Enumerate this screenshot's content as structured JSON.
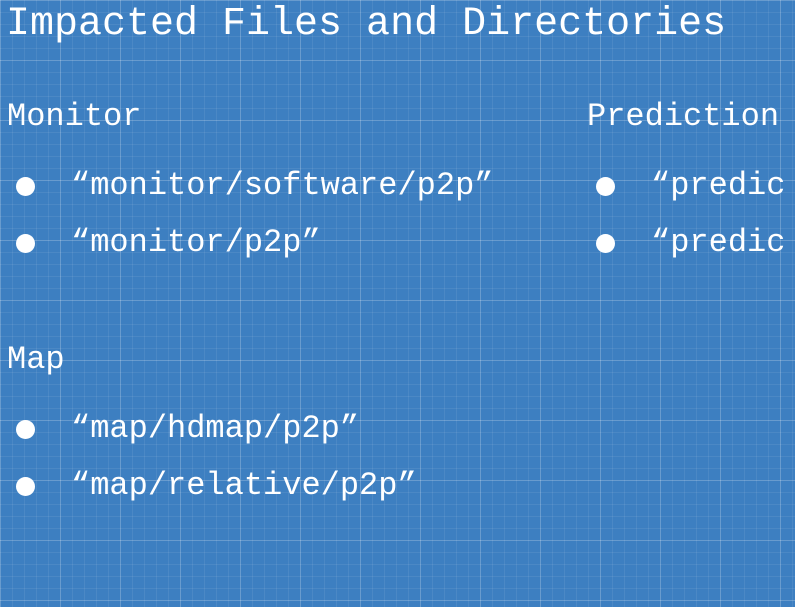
{
  "title": "Impacted Files and Directories",
  "sections": {
    "monitor": {
      "heading": "Monitor",
      "items": [
        "“monitor/software/p2p”",
        "“monitor/p2p”"
      ]
    },
    "prediction": {
      "heading": "Prediction",
      "items": [
        "“predic",
        "“predic"
      ]
    },
    "map": {
      "heading": "Map",
      "items": [
        "“map/hdmap/p2p”",
        "“map/relative/p2p”"
      ]
    }
  },
  "colors": {
    "background": "#3d7fc1",
    "text": "#ffffff"
  }
}
